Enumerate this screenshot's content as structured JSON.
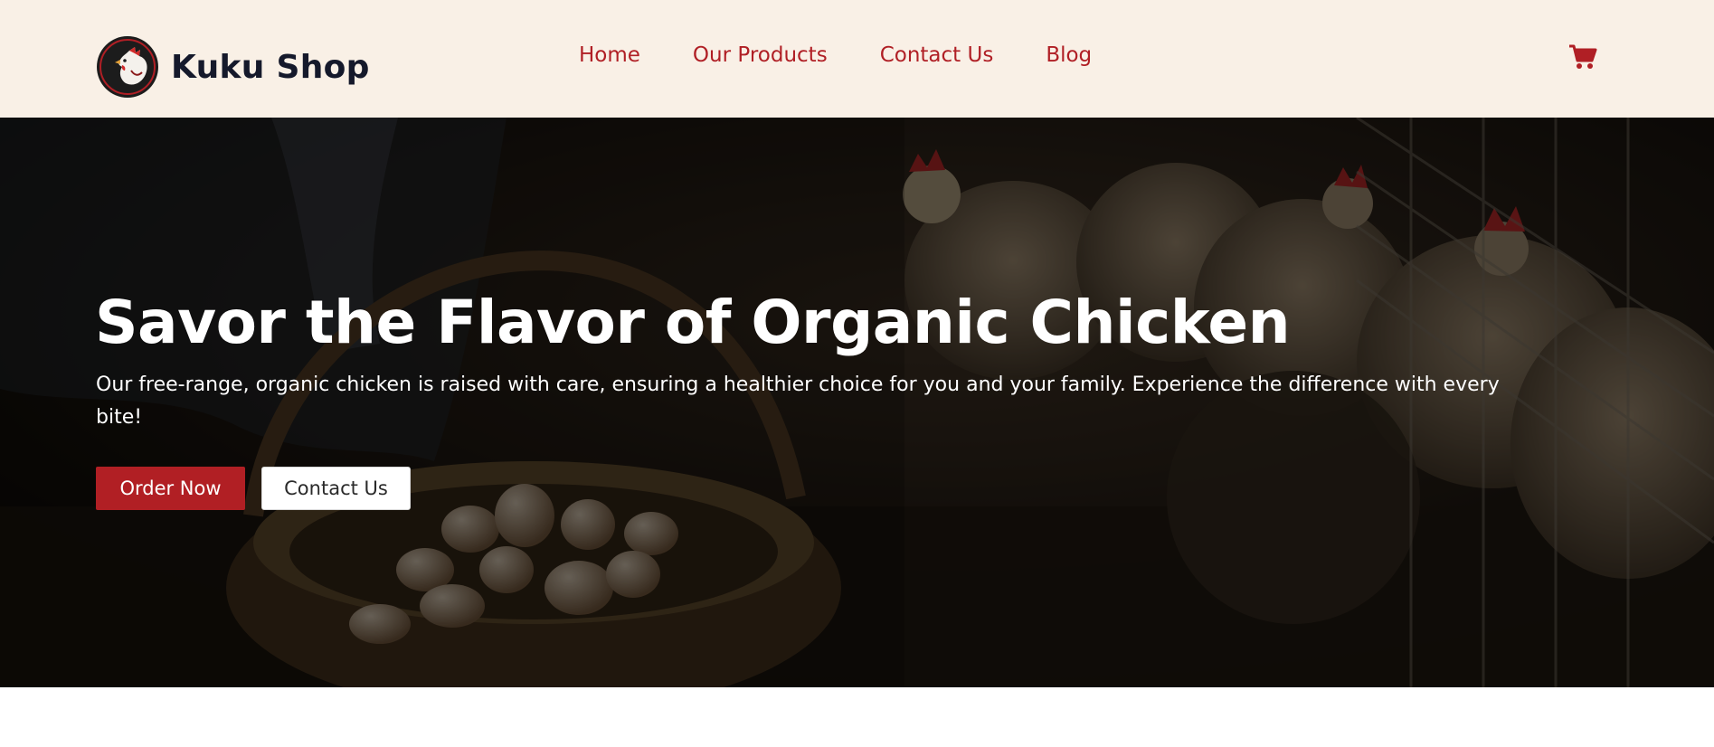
{
  "header": {
    "brand": "Kuku Shop",
    "logo_icon": "rooster-farm-logo",
    "nav": [
      "Home",
      "Our Products",
      "Contact Us",
      "Blog"
    ],
    "cart_icon": "shopping-cart-icon"
  },
  "hero": {
    "title": "Savor the Flavor of Organic Chicken",
    "subtitle": "Our free-range, organic chicken is raised with care, ensuring a healthier choice for you and your family. Experience the difference with every bite!",
    "primary_button": "Order Now",
    "secondary_button": "Contact Us",
    "background_image": "chickens-and-egg-basket-photo"
  },
  "colors": {
    "header_bg": "#f9f0e6",
    "accent": "#b11f24",
    "brand_text": "#15192b",
    "hero_overlay": "#0f0b08"
  }
}
